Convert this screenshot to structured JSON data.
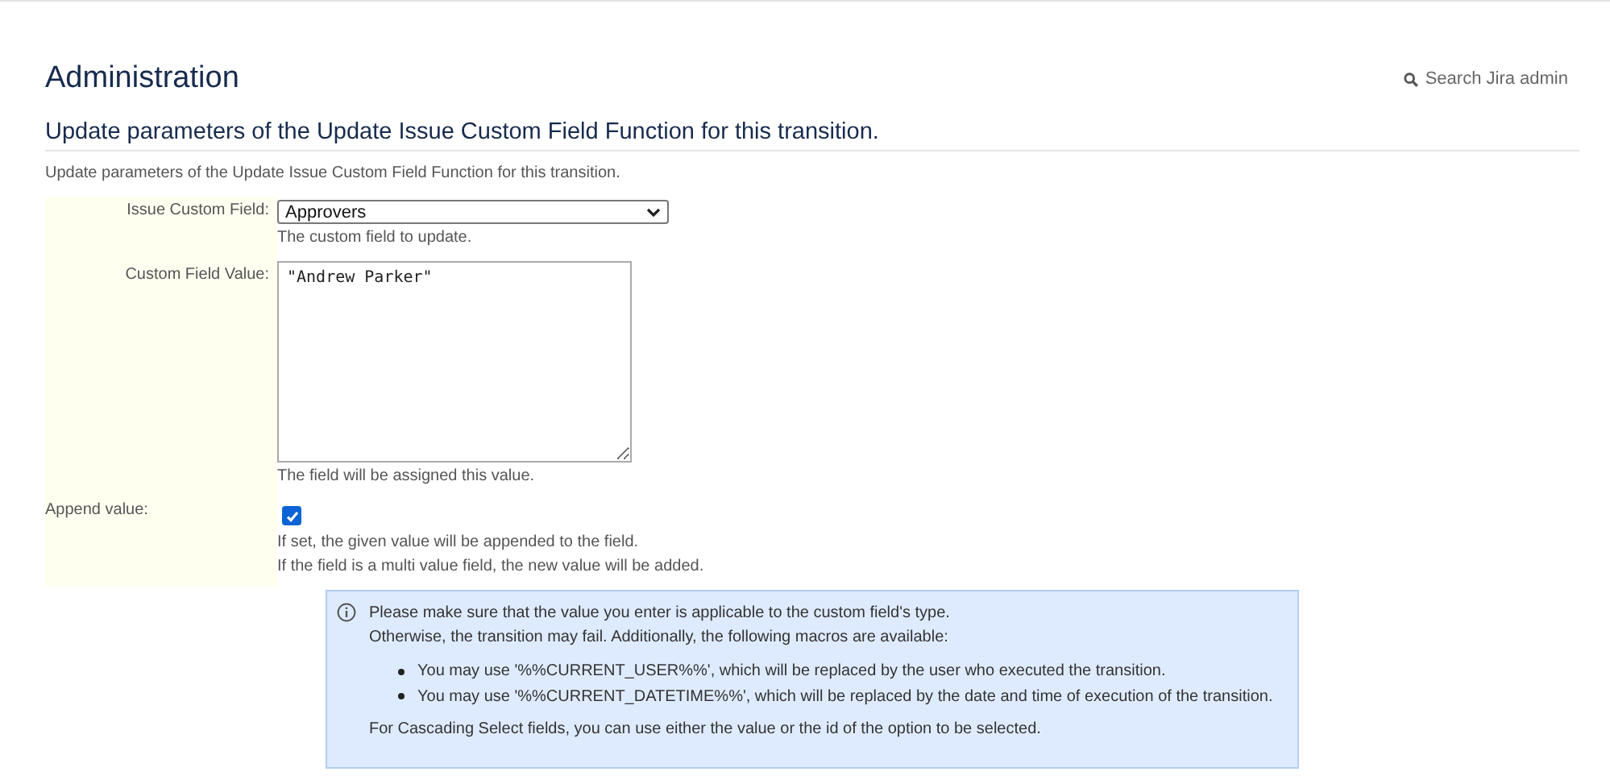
{
  "header": {
    "title": "Administration",
    "search_link": "Search Jira admin"
  },
  "section": {
    "title": "Update parameters of the Update Issue Custom Field Function for this transition.",
    "description": "Update parameters of the Update Issue Custom Field Function for this transition."
  },
  "form": {
    "custom_field": {
      "label": "Issue Custom Field:",
      "value": "Approvers",
      "help": "The custom field to update."
    },
    "field_value": {
      "label": "Custom Field Value:",
      "value": "\"Andrew Parker\"",
      "help": "The field will be assigned this value."
    },
    "append": {
      "label": "Append value:",
      "checked": true,
      "help": [
        "If set, the given value will be appended to the field.",
        "If the field is a multi value field, the new value will be added."
      ]
    }
  },
  "info": {
    "lines": [
      "Please make sure that the value you enter is applicable to the custom field's type.",
      "Otherwise, the transition may fail. Additionally, the following macros are available:"
    ],
    "bullets": [
      "You may use '%%CURRENT_USER%%', which will be replaced by the user who executed the transition.",
      "You may use '%%CURRENT_DATETIME%%', which will be replaced by the date and time of execution of the transition."
    ],
    "footer": "For Cascading Select fields, you can use either the value or the id of the option to be selected."
  }
}
